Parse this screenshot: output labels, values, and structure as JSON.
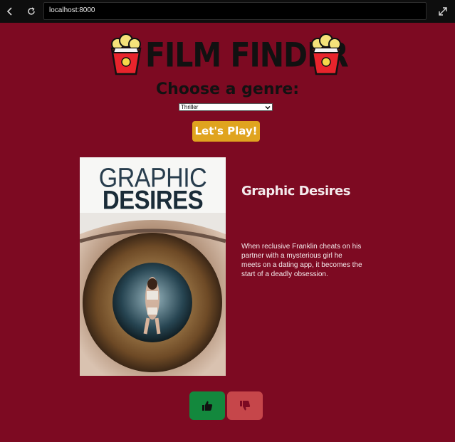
{
  "browser": {
    "url": "localhost:8000"
  },
  "header": {
    "title": "FILM FINDER"
  },
  "genre": {
    "heading": "Choose a genre:",
    "selected": "Thriller"
  },
  "play_button": {
    "label": "Let's Play!"
  },
  "movie": {
    "poster_line1": "GRAPHIC",
    "poster_line2": "DESIRES",
    "title": "Graphic Desires",
    "description": "When reclusive Franklin cheats on his partner with a mysterious girl he meets on a dating app, it becomes the start of a deadly obsession."
  },
  "colors": {
    "background": "#7d0a22",
    "play_button": "#e0a41f",
    "like_button": "#13883d",
    "dislike_button": "#c6464a"
  },
  "icons": {
    "back": "chevron-left-icon",
    "reload": "reload-icon",
    "expand": "expand-icon",
    "popcorn": "popcorn-icon",
    "like": "thumbs-up-icon",
    "dislike": "thumbs-down-icon"
  }
}
